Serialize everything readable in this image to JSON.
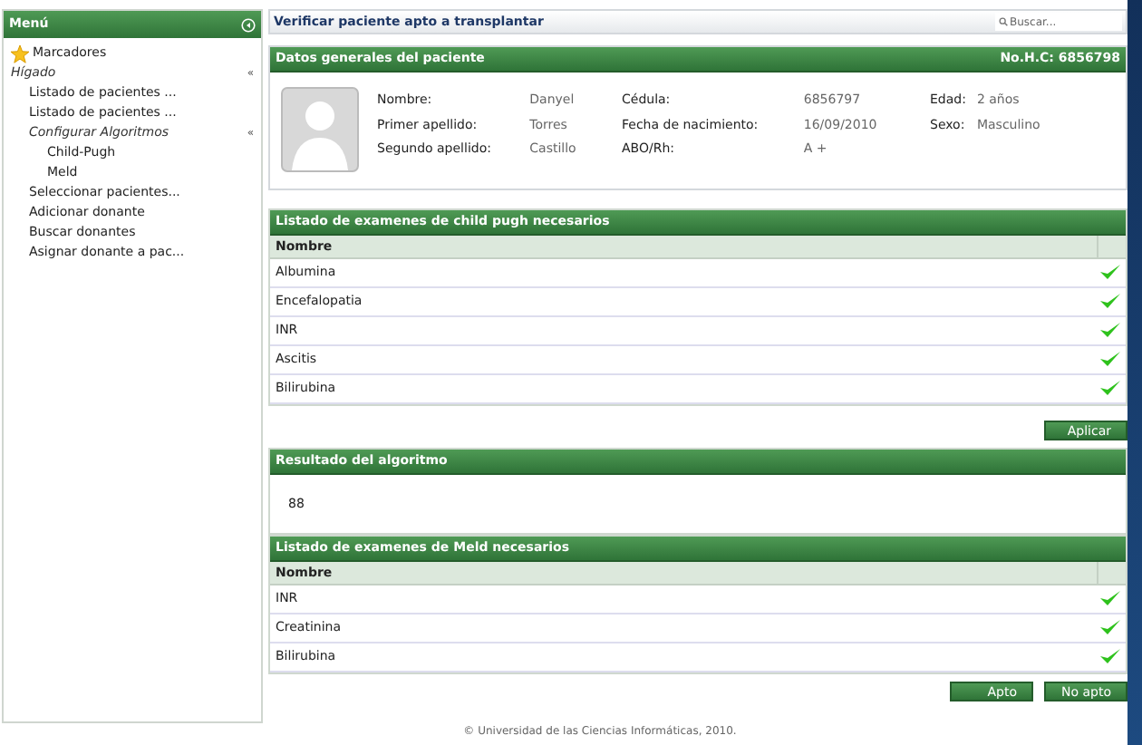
{
  "sidebar": {
    "title": "Menú",
    "items": [
      {
        "label": "Marcadores",
        "kind": "bookmark"
      },
      {
        "label": "Hígado",
        "kind": "folder",
        "expanded": true,
        "toggle": "«",
        "children": [
          {
            "label": "Listado de pacientes ...",
            "kind": "link"
          },
          {
            "label": "Listado de pacientes ...",
            "kind": "link"
          },
          {
            "label": "Configurar Algoritmos",
            "kind": "folder",
            "expanded": true,
            "toggle": "«",
            "children": [
              {
                "label": "Child-Pugh",
                "kind": "link"
              },
              {
                "label": "Meld",
                "kind": "link"
              }
            ]
          },
          {
            "label": "Seleccionar pacientes...",
            "kind": "link"
          },
          {
            "label": "Adicionar donante",
            "kind": "link"
          },
          {
            "label": "Buscar donantes",
            "kind": "link"
          },
          {
            "label": "Asignar donante a pac...",
            "kind": "link"
          }
        ]
      }
    ]
  },
  "page": {
    "title": "Verificar paciente apto a transplantar",
    "search": {
      "placeholder": "Buscar..."
    }
  },
  "patient": {
    "title": "Datos generales del paciente",
    "record": "No.H.C: 6856798",
    "columns": [
      [
        {
          "label": "Nombre:",
          "value": "Danyel"
        },
        {
          "label": "Primer apellido:",
          "value": "Torres"
        },
        {
          "label": "Segundo apellido:",
          "value": "Castillo"
        }
      ],
      [
        {
          "label": "Cédula:",
          "value": "6856797"
        },
        {
          "label": "Fecha de nacimiento:",
          "value": "16/09/2010"
        },
        {
          "label": "ABO/Rh:",
          "value": "A +"
        }
      ],
      [
        {
          "label": "Edad:",
          "value": "2 años"
        },
        {
          "label": "Sexo:",
          "value": "Masculino"
        }
      ]
    ]
  },
  "child_pugh": {
    "title": "Listado de examenes de child pugh necesarios",
    "column": "Nombre",
    "rows": [
      {
        "name": "Albumina",
        "checked": true
      },
      {
        "name": "Encefalopatia",
        "checked": true
      },
      {
        "name": "INR",
        "checked": true
      },
      {
        "name": "Ascitis",
        "checked": true
      },
      {
        "name": "Bilirubina",
        "checked": true
      }
    ],
    "button": "Aplicar"
  },
  "result": {
    "title": "Resultado del algoritmo",
    "value": "88"
  },
  "meld": {
    "title": "Listado de examenes de Meld necesarios",
    "column": "Nombre",
    "rows": [
      {
        "name": "INR",
        "checked": true
      },
      {
        "name": "Creatinina",
        "checked": true
      },
      {
        "name": "Bilirubina",
        "checked": true
      }
    ],
    "buttons": [
      "Apto",
      "No apto"
    ]
  },
  "footer": "© Universidad de las Ciencias Informáticas, 2010."
}
